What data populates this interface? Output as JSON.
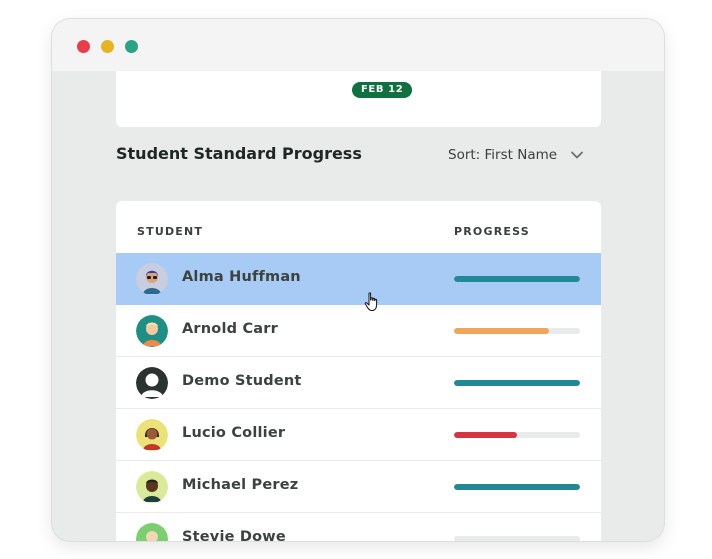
{
  "window": {
    "controls": [
      "close",
      "minimize",
      "zoom"
    ]
  },
  "top_card": {
    "date_badge": "FEB 12"
  },
  "section": {
    "title": "Student Standard Progress",
    "sort_label": "Sort: First Name",
    "sort_icon": "chevron-down-icon"
  },
  "table": {
    "headers": {
      "student": "STUDENT",
      "progress": "PROGRESS"
    },
    "rows": [
      {
        "name": "Alma Huffman",
        "progress": 1.0,
        "color": "#238896",
        "avatar_bg": "#c8cde0",
        "selected": true
      },
      {
        "name": "Arnold Carr",
        "progress": 0.75,
        "color": "#f0a55a",
        "avatar_bg": "#1f8f86",
        "selected": false
      },
      {
        "name": "Demo Student",
        "progress": 1.0,
        "color": "#238896",
        "avatar_bg": "#2b3331",
        "selected": false
      },
      {
        "name": "Lucio Collier",
        "progress": 0.5,
        "color": "#d63442",
        "avatar_bg": "#ece27a",
        "selected": false
      },
      {
        "name": "Michael Perez",
        "progress": 1.0,
        "color": "#238896",
        "avatar_bg": "#d9ea9a",
        "selected": false
      },
      {
        "name": "Stevie Dowe",
        "progress": 0.0,
        "color": "#238896",
        "avatar_bg": "#7ccf6e",
        "selected": false
      }
    ]
  },
  "colors": {
    "badge": "#0f7040",
    "selected_row": "#a7cbf4",
    "teal": "#238896",
    "orange": "#f0a55a",
    "red": "#d63442"
  }
}
